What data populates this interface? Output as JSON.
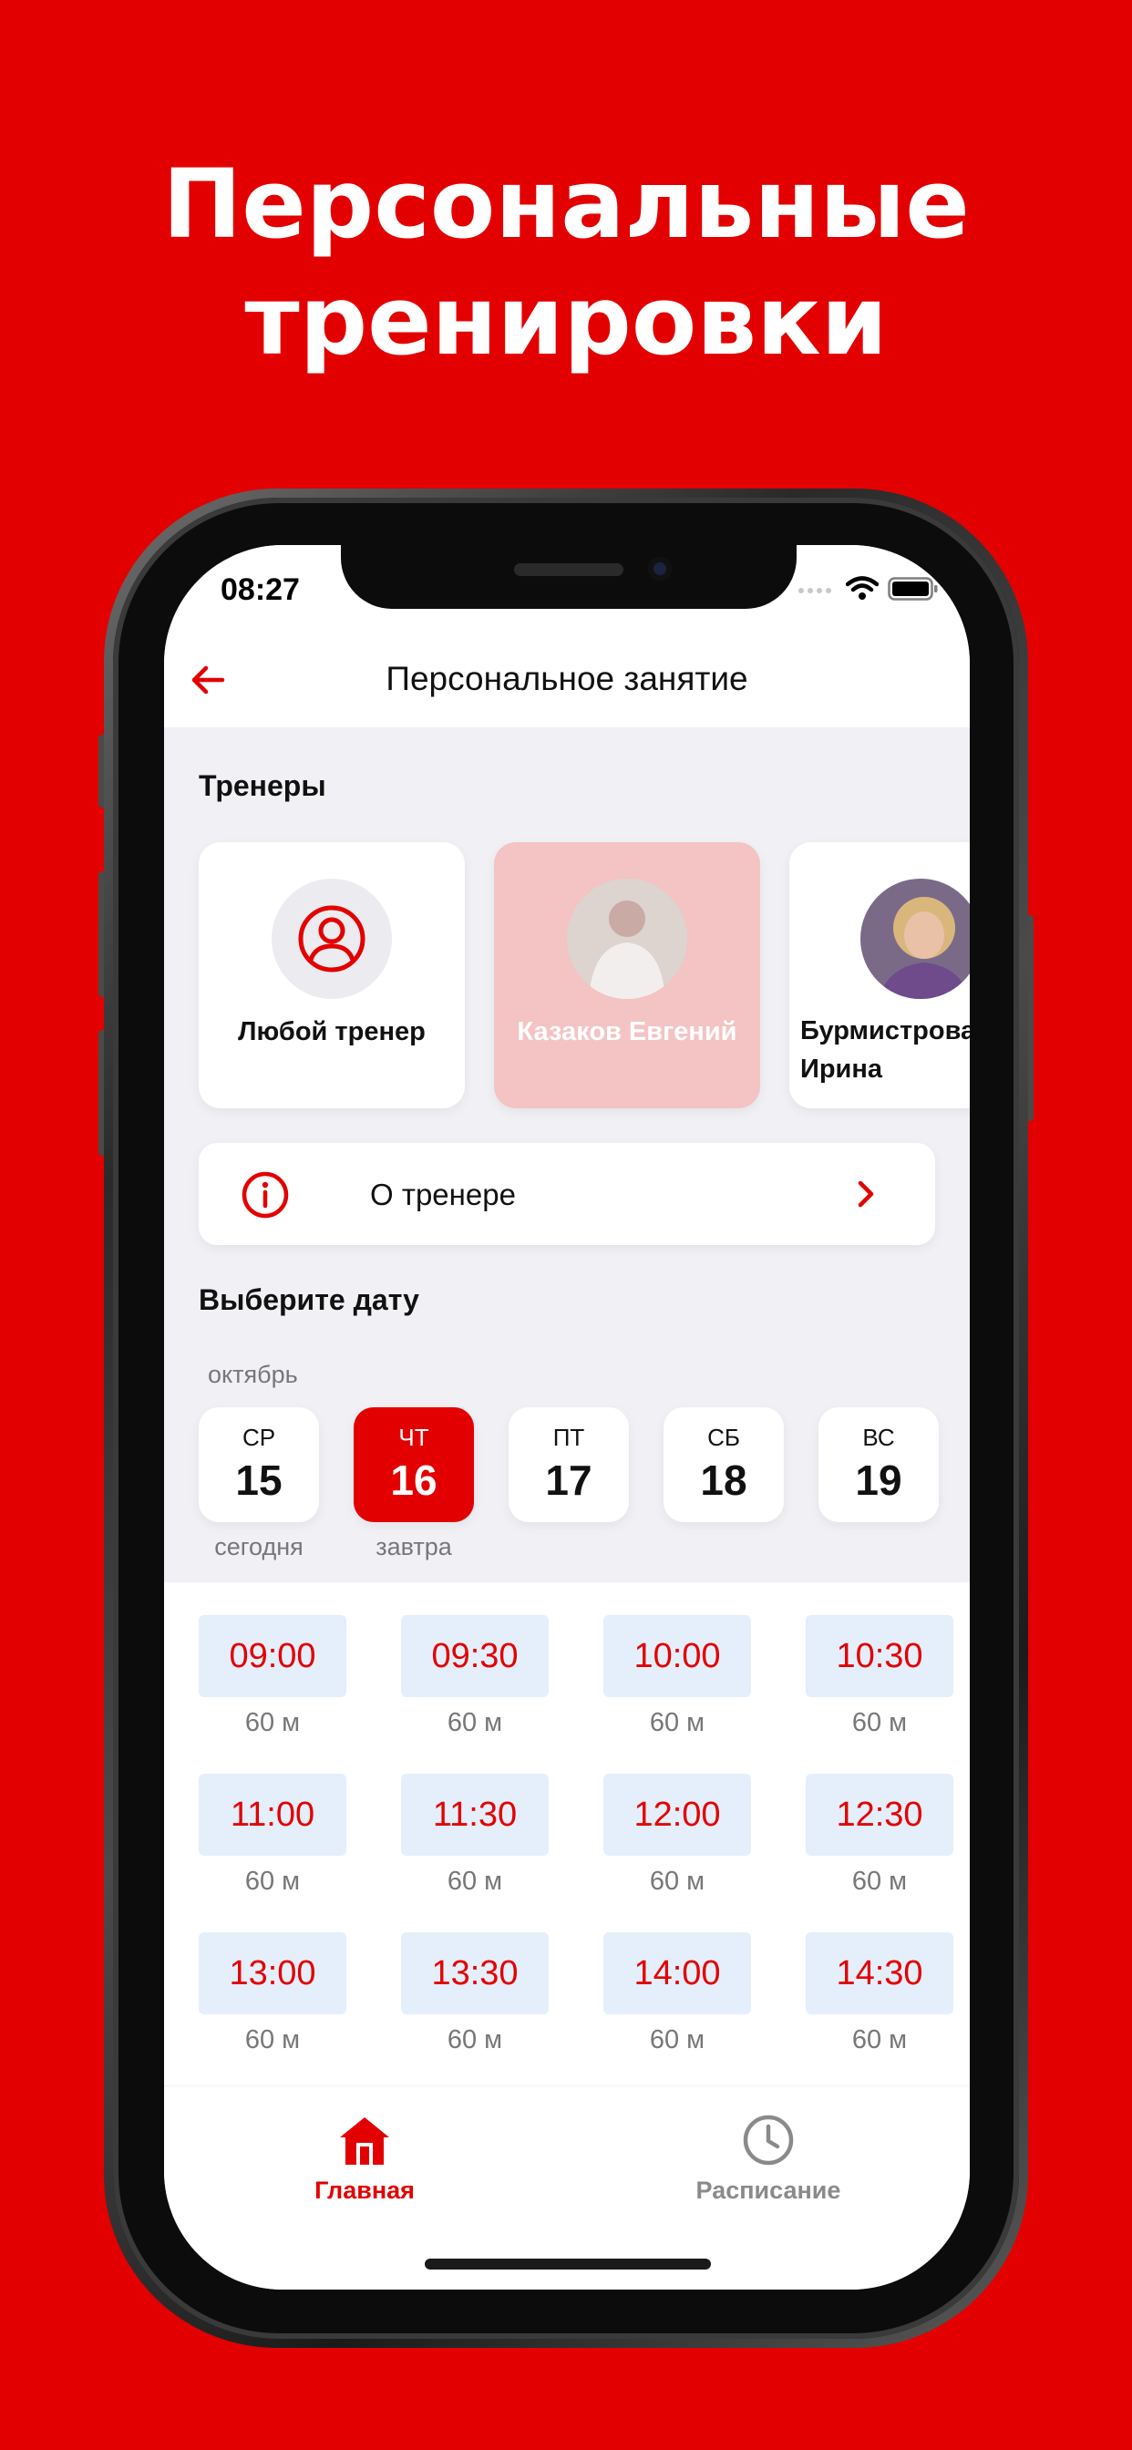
{
  "headline": {
    "line1": "Персональные",
    "line2": "тренировки"
  },
  "status_bar": {
    "time": "08:27"
  },
  "nav": {
    "title": "Персональное занятие"
  },
  "trainers": {
    "section_title": "Тренеры",
    "items": [
      {
        "name": "Любой тренер",
        "avatar": "user-icon"
      },
      {
        "name": "Казаков Евгений",
        "avatar": "photo"
      },
      {
        "name_line1": "Бурмистрова",
        "name_line2": "Ирина",
        "avatar": "photo"
      }
    ]
  },
  "about": {
    "label": "О тренере",
    "icon": "info-icon"
  },
  "date": {
    "section_title": "Выберите дату",
    "month": "октябрь",
    "days": [
      {
        "dow": "СР",
        "num": "15",
        "caption": "сегодня"
      },
      {
        "dow": "ЧТ",
        "num": "16",
        "caption": "завтра"
      },
      {
        "dow": "ПТ",
        "num": "17"
      },
      {
        "dow": "СБ",
        "num": "18"
      },
      {
        "dow": "ВС",
        "num": "19"
      }
    ]
  },
  "slots": [
    {
      "time": "09:00",
      "duration": "60 м"
    },
    {
      "time": "09:30",
      "duration": "60 м"
    },
    {
      "time": "10:00",
      "duration": "60 м"
    },
    {
      "time": "10:30",
      "duration": "60 м"
    },
    {
      "time": "11:00",
      "duration": "60 м"
    },
    {
      "time": "11:30",
      "duration": "60 м"
    },
    {
      "time": "12:00",
      "duration": "60 м"
    },
    {
      "time": "12:30",
      "duration": "60 м"
    },
    {
      "time": "13:00",
      "duration": "60 м"
    },
    {
      "time": "13:30",
      "duration": "60 м"
    },
    {
      "time": "14:00",
      "duration": "60 м"
    },
    {
      "time": "14:30",
      "duration": "60 м"
    }
  ],
  "tabs": [
    {
      "label": "Главная",
      "icon": "home-icon",
      "active": true
    },
    {
      "label": "Расписание",
      "icon": "clock-icon",
      "active": false
    }
  ],
  "colors": {
    "brand": "#e30000",
    "slot_bg": "#e4effb",
    "muted": "#777777"
  }
}
